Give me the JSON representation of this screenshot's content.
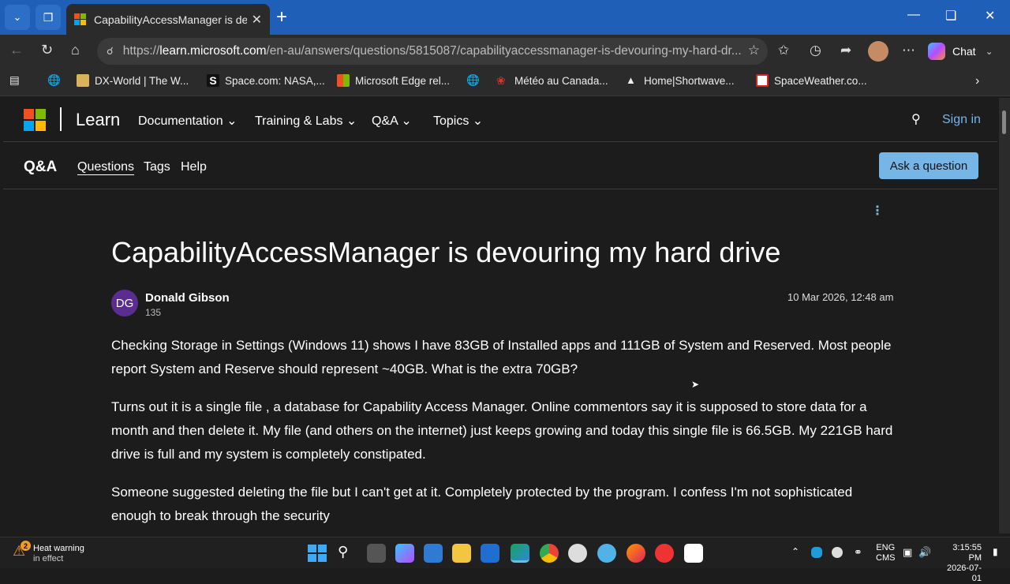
{
  "browser": {
    "tab_title": "CapabilityAccessManager is devou",
    "url_prefix": "https://",
    "url_host": "learn.microsoft.com",
    "url_path": "/en-au/answers/questions/5815087/capabilityaccessmanager-is-devouring-my-hard-dr...",
    "chat_label": "Chat",
    "bookmarks": [
      {
        "label": "DX-World | The W..."
      },
      {
        "label": "Space.com: NASA,..."
      },
      {
        "label": "Microsoft Edge rel..."
      },
      {
        "label": "Météo au Canada..."
      },
      {
        "label": "Home|Shortwave..."
      },
      {
        "label": "SpaceWeather.co..."
      }
    ]
  },
  "site": {
    "brand": "Learn",
    "nav": [
      "Documentation",
      "Training & Labs",
      "Q&A",
      "Topics"
    ],
    "sign_in": "Sign in",
    "qa_title": "Q&A",
    "qa_links": [
      "Questions",
      "Tags",
      "Help"
    ],
    "ask_button": "Ask a question"
  },
  "question": {
    "title": "CapabilityAccessManager is devouring my hard drive",
    "author_initials": "DG",
    "author_name": "Donald Gibson",
    "author_rep": "135",
    "date": "10 Mar 2026, 12:48 am",
    "paragraphs": [
      "Checking Storage in Settings (Windows 11) shows I have 83GB of Installed apps and 111GB of System and Reserved. Most people report System and Reserve should represent ~40GB. What is the extra 70GB?",
      "Turns out it is a single file , a database for Capability Access Manager. Online commentors say it is supposed to store data for a month and then delete it. My file (and others on the internet) just keeps growing and today this single file is 66.5GB. My 221GB hard drive is full and my system is completely constipated.",
      "Someone suggested deleting the file but I can't get at it. Completely protected by the program. I confess I'm not sophisticated enough to break through the security"
    ]
  },
  "taskbar": {
    "warning_badge": "2",
    "warning_title": "Heat warning",
    "warning_sub": "in effect",
    "lang_top": "ENG",
    "lang_bottom": "CMS",
    "time": "3:15:55 PM",
    "date": "2026-07-01"
  },
  "colors": {
    "accent": "#75b6e7",
    "titlebar": "#1f5fb8",
    "avatar": "#5c2d91"
  }
}
